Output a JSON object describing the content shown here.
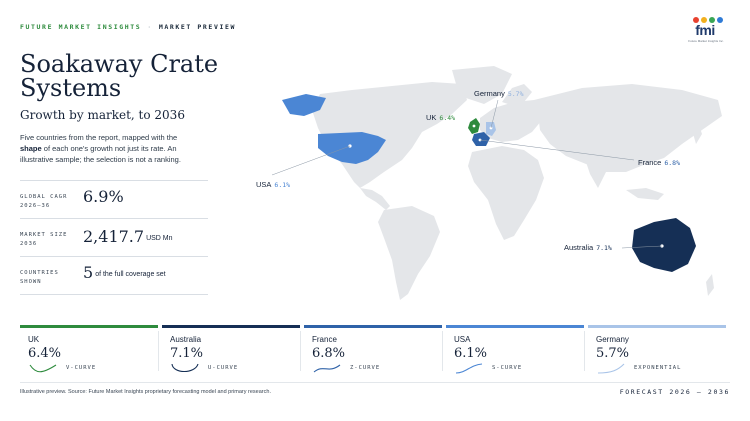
{
  "header": {
    "brand": "FUTURE MARKET INSIGHTS",
    "separator": "·",
    "section": "MARKET PREVIEW"
  },
  "logo": {
    "word": "fmi",
    "tagline": "Future Market Insights Inc."
  },
  "title": "Soakaway Crate Systems",
  "subtitle": "Growth by market, to 2036",
  "intro": {
    "before": "Five countries from the report, mapped with the ",
    "bold": "shape",
    "after": " of each one's growth not just its rate. An illustrative sample; the selection is not a ranking."
  },
  "stats": [
    {
      "label": "GLOBAL CAGR 2026–36",
      "value": "6.9%",
      "unit": ""
    },
    {
      "label": "MARKET SIZE 2036",
      "value": "2,417.7",
      "unit": "USD Mn"
    },
    {
      "label": "COUNTRIES SHOWN",
      "value": "5",
      "unit": "of the full coverage set"
    }
  ],
  "map_labels": [
    {
      "name": "Germany",
      "value": "5.7%"
    },
    {
      "name": "UK",
      "value": "6.4%"
    },
    {
      "name": "France",
      "value": "6.8%"
    },
    {
      "name": "USA",
      "value": "6.1%"
    },
    {
      "name": "Australia",
      "value": "7.1%"
    }
  ],
  "chart_data": {
    "type": "table",
    "title": "Soakaway Crate Systems",
    "subtitle": "Growth by market, to 2036",
    "rows": [
      {
        "country": "UK",
        "cagr": 6.4,
        "label": "6.4%",
        "curve": "V-CURVE",
        "color": "#2e8b3d"
      },
      {
        "country": "Australia",
        "cagr": 7.1,
        "label": "7.1%",
        "curve": "U-CURVE",
        "color": "#152f55"
      },
      {
        "country": "France",
        "cagr": 6.8,
        "label": "6.8%",
        "curve": "Z-CURVE",
        "color": "#2f62a8"
      },
      {
        "country": "USA",
        "cagr": 6.1,
        "label": "6.1%",
        "curve": "S-CURVE",
        "color": "#4b86d4"
      },
      {
        "country": "Germany",
        "cagr": 5.7,
        "label": "5.7%",
        "curve": "EXPONENTIAL",
        "color": "#a9c4e8"
      }
    ]
  },
  "footer": {
    "note": "Illustrative preview. Source: Future Market Insights proprietary forecasting model and primary research.",
    "forecast": "FORECAST 2026 – 2036"
  },
  "colors": {
    "land": "#e4e6e9",
    "uk": "#2e8b3d",
    "australia": "#152f55",
    "france": "#2f62a8",
    "usa": "#4b86d4",
    "germany": "#a9c4e8"
  }
}
